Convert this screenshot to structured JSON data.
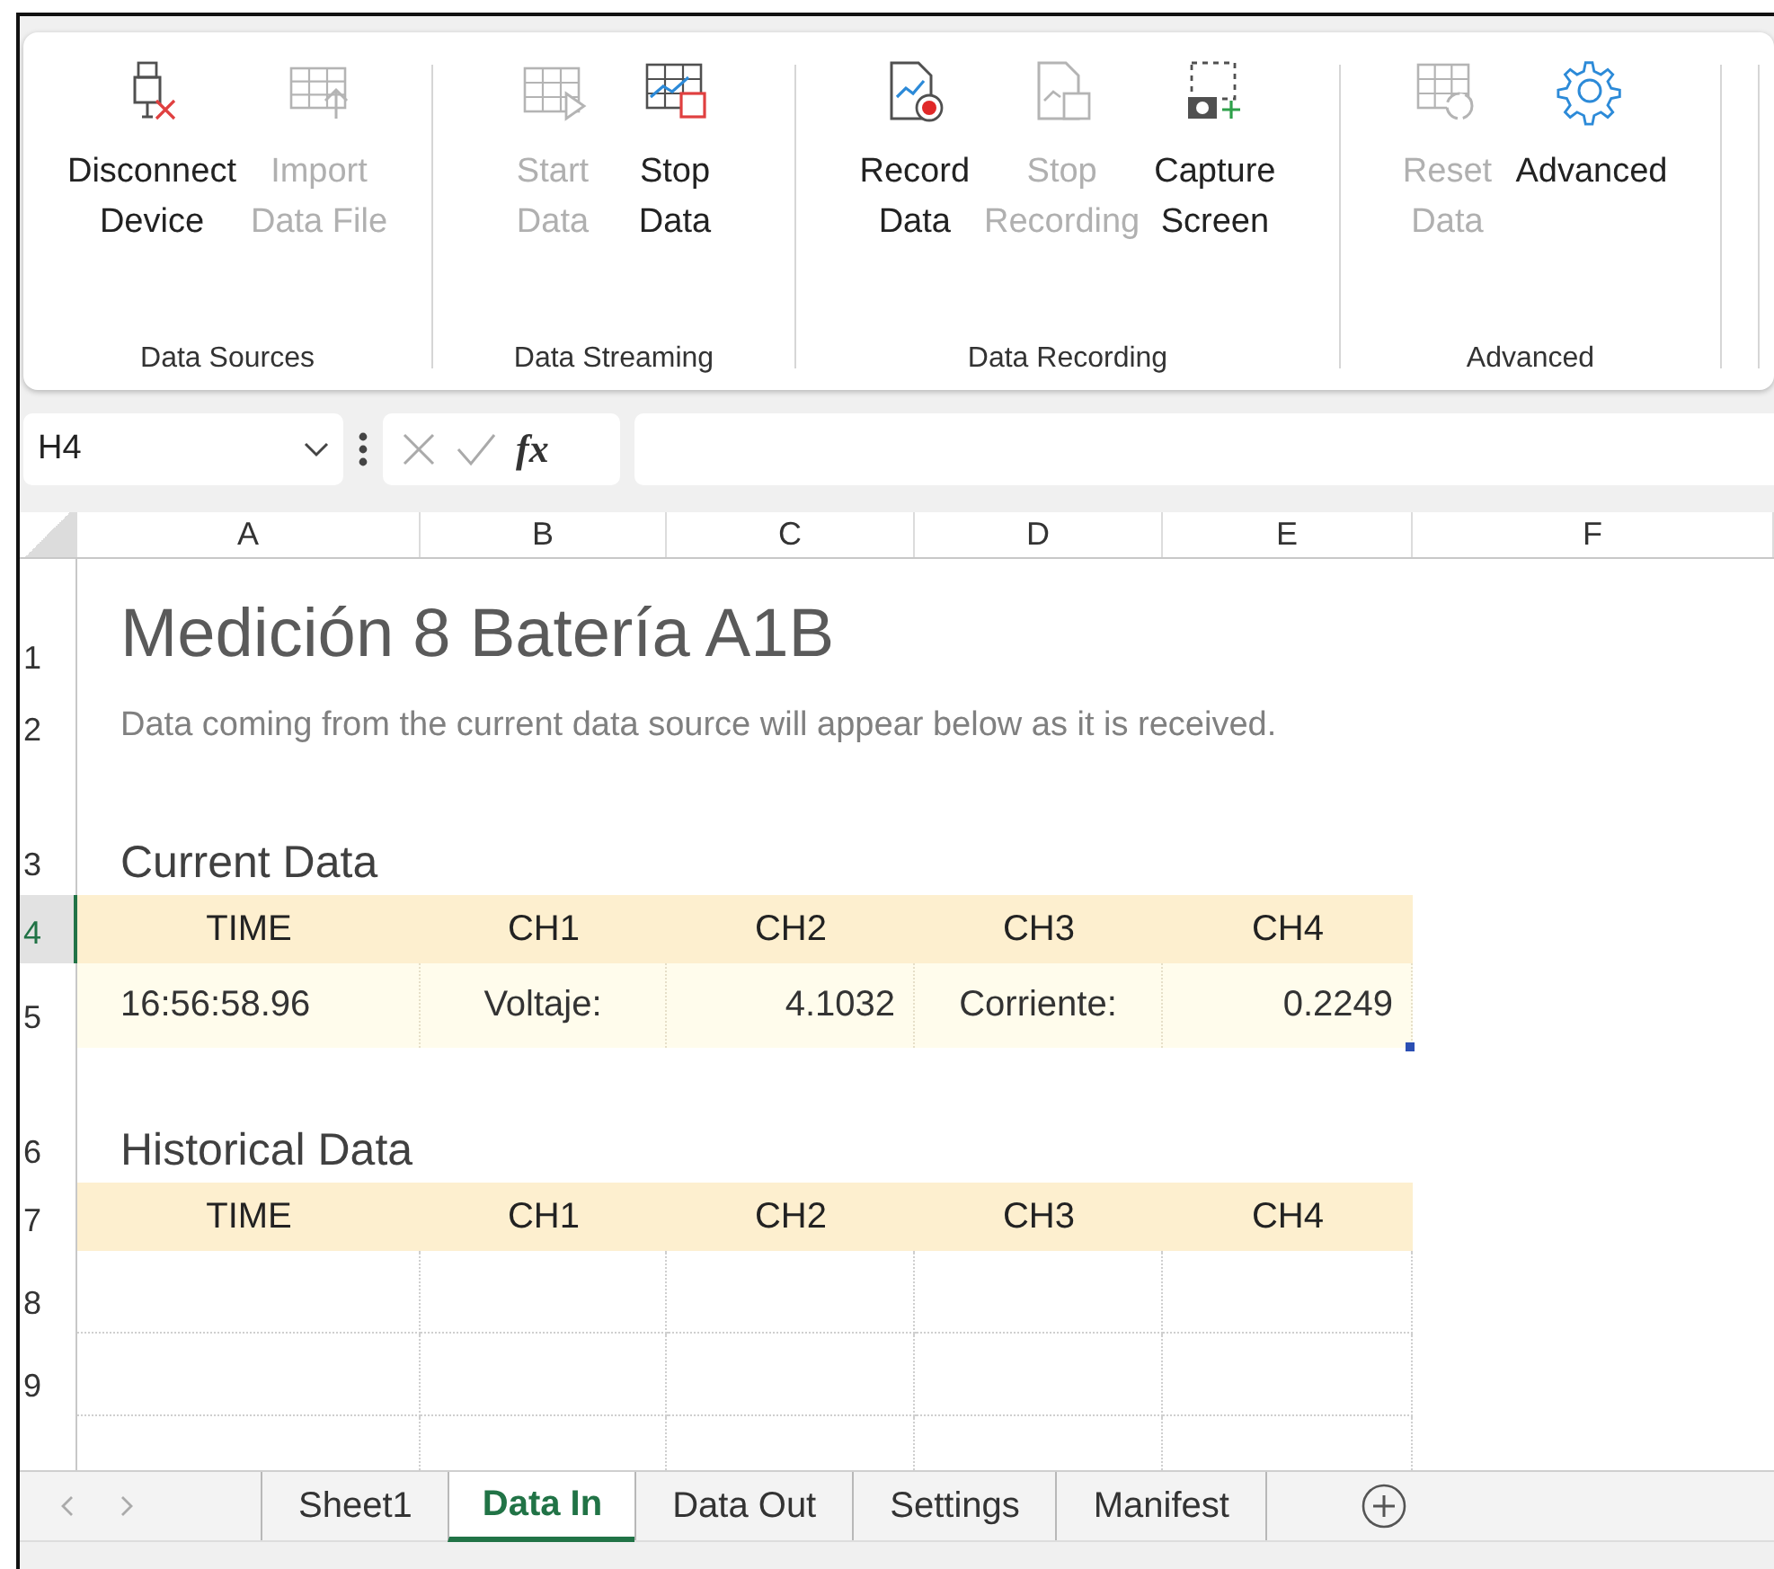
{
  "ribbon": {
    "groups": [
      {
        "label": "Data Sources",
        "buttons": [
          {
            "kind": "disconnect",
            "lines": [
              "Disconnect",
              "Device"
            ],
            "disabled": false
          },
          {
            "kind": "import",
            "lines": [
              "Import",
              "Data File"
            ],
            "disabled": true
          }
        ]
      },
      {
        "label": "Data Streaming",
        "buttons": [
          {
            "kind": "start",
            "lines": [
              "Start",
              "Data"
            ],
            "disabled": true
          },
          {
            "kind": "stop",
            "lines": [
              "Stop",
              "Data"
            ],
            "disabled": false
          }
        ]
      },
      {
        "label": "Data Recording",
        "buttons": [
          {
            "kind": "record",
            "lines": [
              "Record",
              "Data"
            ],
            "disabled": false
          },
          {
            "kind": "stop-record",
            "lines": [
              "Stop",
              "Recording"
            ],
            "disabled": true
          },
          {
            "kind": "capture",
            "lines": [
              "Capture",
              "Screen"
            ],
            "disabled": false
          }
        ]
      },
      {
        "label": "Advanced",
        "buttons": [
          {
            "kind": "reset",
            "lines": [
              "Reset",
              "Data"
            ],
            "disabled": true
          },
          {
            "kind": "gear",
            "lines": [
              "Advanced"
            ],
            "disabled": false
          }
        ]
      }
    ]
  },
  "formula_bar": {
    "name_box": "H4",
    "function_label": "fx"
  },
  "sheet": {
    "columns": [
      "A",
      "B",
      "C",
      "D",
      "E",
      "F"
    ],
    "rows": [
      {
        "number": "1",
        "selected": false,
        "kind": "title",
        "text": "Medición 8 Batería A1B"
      },
      {
        "number": "2",
        "selected": false,
        "kind": "note",
        "text": "Data coming from the current data source will appear below as it is received."
      },
      {
        "number": "3",
        "selected": false,
        "kind": "section",
        "text": "Current Data"
      },
      {
        "number": "4",
        "selected": true,
        "kind": "header",
        "cells": [
          "TIME",
          "CH1",
          "CH2",
          "CH3",
          "CH4"
        ]
      },
      {
        "number": "5",
        "selected": false,
        "kind": "data",
        "cells": [
          "16:56:58.96",
          "Voltaje:",
          "4.1032",
          "Corriente:",
          "0.2249"
        ]
      },
      {
        "number": "6",
        "selected": false,
        "kind": "section",
        "text": "Historical Data"
      },
      {
        "number": "7",
        "selected": false,
        "kind": "header",
        "cells": [
          "TIME",
          "CH1",
          "CH2",
          "CH3",
          "CH4"
        ]
      },
      {
        "number": "8",
        "selected": false,
        "kind": "empty"
      },
      {
        "number": "9",
        "selected": false,
        "kind": "empty"
      }
    ]
  },
  "sheet_tabs": [
    {
      "label": "Sheet1",
      "selected": false
    },
    {
      "label": "Data In",
      "selected": true
    },
    {
      "label": "Data Out",
      "selected": false
    },
    {
      "label": "Settings",
      "selected": false
    },
    {
      "label": "Manifest",
      "selected": false
    }
  ]
}
